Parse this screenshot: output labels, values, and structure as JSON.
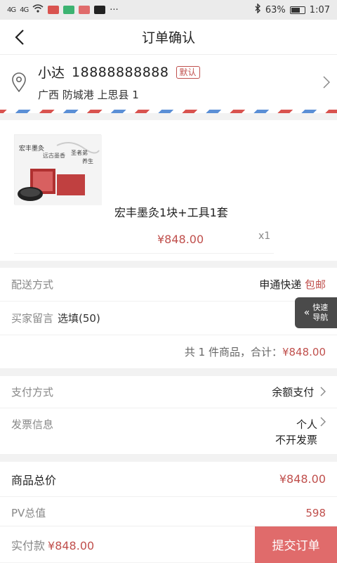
{
  "status_bar": {
    "signal1": "4G",
    "signal2": "4G",
    "battery": "63%",
    "time": "1:07"
  },
  "nav": {
    "title": "订单确认"
  },
  "address": {
    "name": "小达",
    "phone": "18888888888",
    "default_label": "默认",
    "detail": "广西 防城港 上思县 1"
  },
  "product": {
    "title": "宏丰墨灸1块+工具1套",
    "price": "¥848.00",
    "quantity": "x1",
    "image_text": [
      "宏丰墨灸",
      "远古墨香",
      "圣者弟",
      "养生"
    ]
  },
  "delivery": {
    "label": "配送方式",
    "value": "申通快递",
    "tag": "包邮"
  },
  "message": {
    "label": "买家留言",
    "placeholder": "选填(50)"
  },
  "summary": {
    "prefix": "共 1 件商品，合计：",
    "total": "¥848.00"
  },
  "payment": {
    "label": "支付方式",
    "value": "余额支付"
  },
  "invoice": {
    "label": "发票信息",
    "value1": "个人",
    "value2": "不开发票"
  },
  "goods_total": {
    "label": "商品总价",
    "value": "¥848.00"
  },
  "pv_total": {
    "label": "PV总值",
    "value": "598"
  },
  "quick_nav": {
    "line1": "快速",
    "line2": "导航"
  },
  "footer": {
    "paid_label": "实付款",
    "paid_amount": "¥848.00",
    "submit": "提交订单"
  },
  "colors": {
    "accent": "#c0504d",
    "submit_bg": "#e06b6b",
    "quick_nav_bg": "#4a4a4a"
  }
}
